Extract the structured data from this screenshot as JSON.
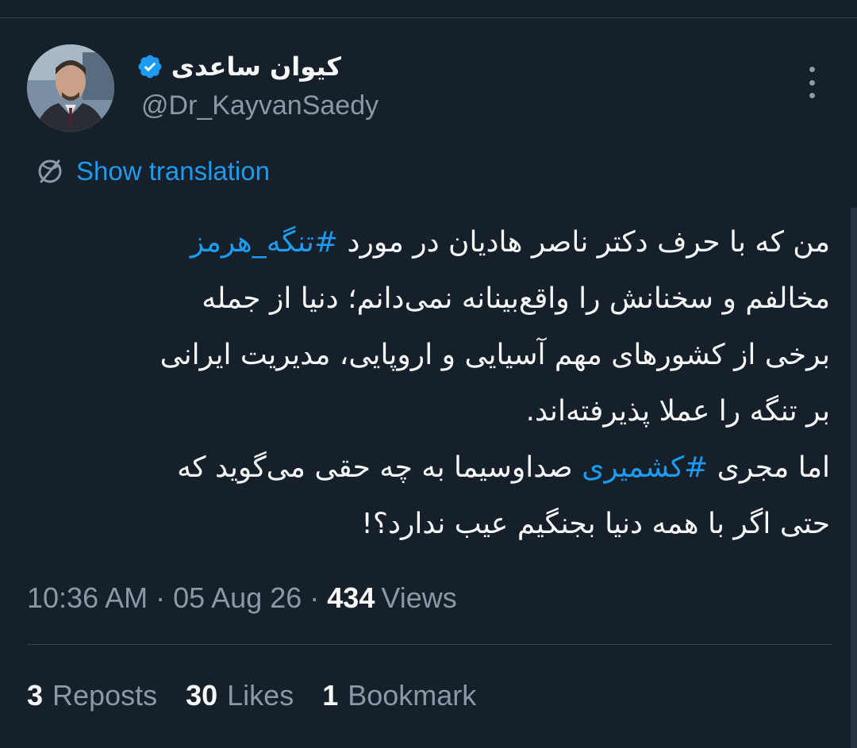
{
  "author": {
    "display_name": "کیوان ساعدی",
    "handle": "@Dr_KayvanSaedy",
    "verified_icon": "verified-badge-icon",
    "avatar_icon": "avatar-photo"
  },
  "translate": {
    "icon": "globe-icon",
    "label": "Show translation"
  },
  "more_icon": "more-vertical-icon",
  "tweet": {
    "line1_pre": "من که با حرف دکتر ناصر هادیان در مورد ",
    "line1_tag": "#تنگه_هرمز",
    "line2": "مخالفم و سخنانش را واقع‌بینانه نمی‌دانم؛ دنیا از جمله",
    "line3": "برخی از کشورهای مهم آسیایی و اروپایی، مدیریت ایرانی",
    "line4": "بر تنگه را عملا پذیرفته‌اند.",
    "line5_pre": "اما مجری ",
    "line5_tag": "#کشمیری",
    "line5_post": " صداوسیما به چه حقی می‌گوید که",
    "line6": "حتی اگر با همه دنیا بجنگیم عیب ندارد؟!"
  },
  "meta": {
    "time": "10:36 AM",
    "sep1": "·",
    "date": "05 Aug 26",
    "sep2": "·",
    "views_count": "434",
    "views_label": "Views"
  },
  "stats": {
    "reposts_count": "3",
    "reposts_label": "Reposts",
    "likes_count": "30",
    "likes_label": "Likes",
    "bookmarks_count": "1",
    "bookmarks_label": "Bookmark"
  },
  "colors": {
    "background": "#15202b",
    "text": "#f7f9f9",
    "secondary": "#8b98a5",
    "accent": "#1d9bf0",
    "divider": "#38444d"
  }
}
